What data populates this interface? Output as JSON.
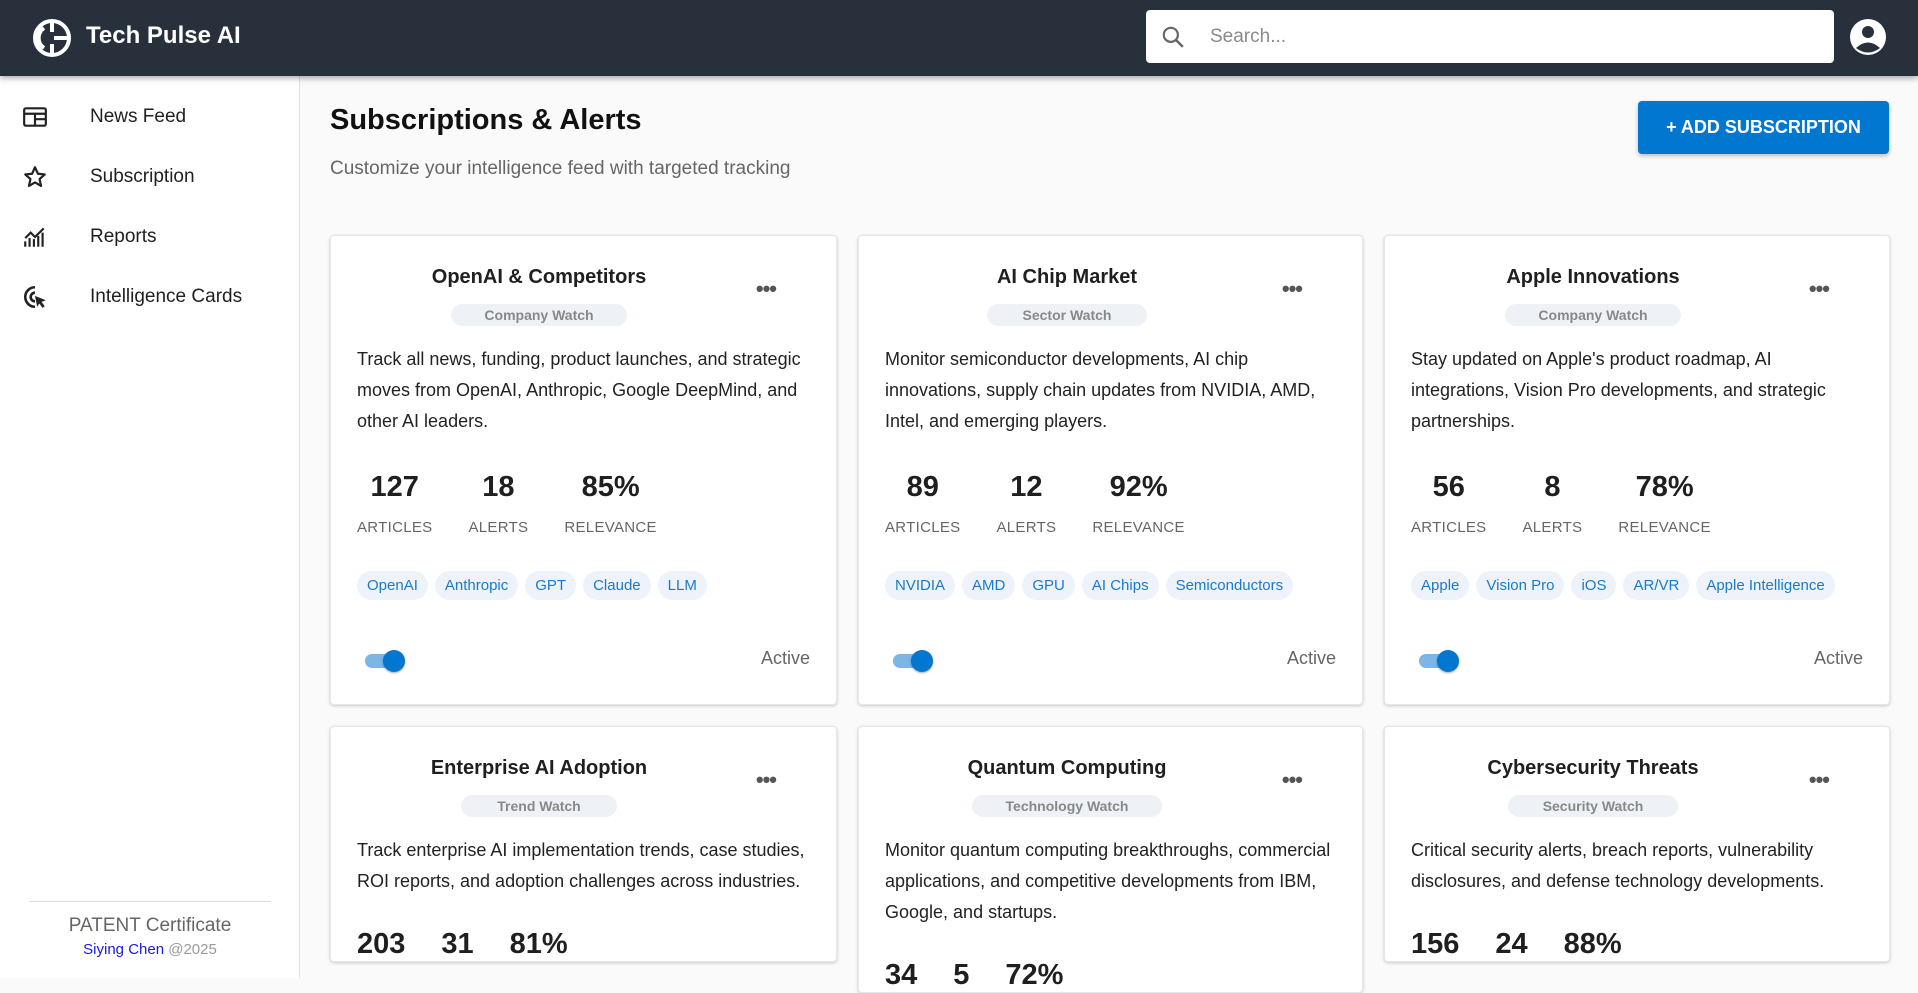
{
  "app": {
    "title": "Tech Pulse AI"
  },
  "search": {
    "placeholder": "Search..."
  },
  "sidebar": {
    "items": [
      {
        "label": "News Feed",
        "icon": "newspaper-icon"
      },
      {
        "label": "Subscription",
        "icon": "star-icon"
      },
      {
        "label": "Reports",
        "icon": "chart-icon"
      },
      {
        "label": "Intelligence Cards",
        "icon": "cursor-target-icon"
      }
    ],
    "footer": {
      "title": "PATENT Certificate",
      "author": "Siying Chen",
      "year": " @2025"
    }
  },
  "page": {
    "title": "Subscriptions & Alerts",
    "subtitle": "Customize your intelligence feed with targeted tracking",
    "add_button": "+ ADD SUBSCRIPTION"
  },
  "stat_labels": {
    "articles": "ARTICLES",
    "alerts": "ALERTS",
    "relevance": "RELEVANCE"
  },
  "colors": {
    "accent": "#0277cf",
    "header": "#27303b"
  },
  "cards": [
    {
      "title": "OpenAI & Competitors",
      "type": "Company Watch",
      "description": "Track all news, funding, product launches, and strategic moves from OpenAI, Anthropic, Google DeepMind, and other AI leaders.",
      "articles": "127",
      "alerts": "18",
      "relevance": "85%",
      "tags": [
        "OpenAI",
        "Anthropic",
        "GPT",
        "Claude",
        "LLM"
      ],
      "status": "Active",
      "enabled": true
    },
    {
      "title": "AI Chip Market",
      "type": "Sector Watch",
      "description": "Monitor semiconductor developments, AI chip innovations, supply chain updates from NVIDIA, AMD, Intel, and emerging players.",
      "articles": "89",
      "alerts": "12",
      "relevance": "92%",
      "tags": [
        "NVIDIA",
        "AMD",
        "GPU",
        "AI Chips",
        "Semiconductors"
      ],
      "status": "Active",
      "enabled": true
    },
    {
      "title": "Apple Innovations",
      "type": "Company Watch",
      "description": "Stay updated on Apple's product roadmap, AI integrations, Vision Pro developments, and strategic partnerships.",
      "articles": "56",
      "alerts": "8",
      "relevance": "78%",
      "tags": [
        "Apple",
        "Vision Pro",
        "iOS",
        "AR/VR",
        "Apple Intelligence"
      ],
      "status": "Active",
      "enabled": true
    },
    {
      "title": "Enterprise AI Adoption",
      "type": "Trend Watch",
      "description": "Track enterprise AI implementation trends, case studies, ROI reports, and adoption challenges across industries.",
      "articles": "203",
      "alerts": "31",
      "relevance": "81%"
    },
    {
      "title": "Quantum Computing",
      "type": "Technology Watch",
      "description": "Monitor quantum computing breakthroughs, commercial applications, and competitive developments from IBM, Google, and startups.",
      "articles": "34",
      "alerts": "5",
      "relevance": "72%"
    },
    {
      "title": "Cybersecurity Threats",
      "type": "Security Watch",
      "description": "Critical security alerts, breach reports, vulnerability disclosures, and defense technology developments.",
      "articles": "156",
      "alerts": "24",
      "relevance": "88%"
    }
  ]
}
